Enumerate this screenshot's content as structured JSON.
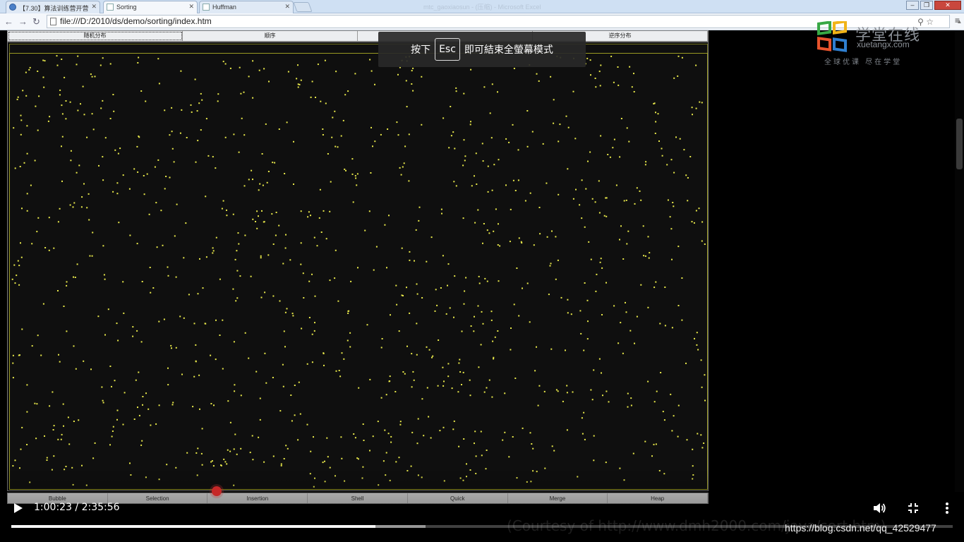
{
  "browser": {
    "tabs": [
      {
        "label": "【7.30】算法训练营开营",
        "active": false
      },
      {
        "label": "Sorting",
        "active": true
      },
      {
        "label": "Huffman",
        "active": false
      }
    ],
    "window_title": "mtc_gaoxiaosun - (压缩) - Microsoft Excel",
    "url": "file:///D:/2010/ds/demo/sorting/index.htm"
  },
  "page": {
    "distribution_buttons": [
      "随机分布",
      "顺序",
      "",
      "逆序分布"
    ],
    "selected_distribution": "随机分布",
    "algorithms": [
      "Bubble",
      "Selection",
      "Insertion",
      "Shell",
      "Quick",
      "Merge",
      "Heap"
    ],
    "dot_color": "#e8e84a"
  },
  "fullscreen_toast": {
    "prefix": "按下",
    "key": "Esc",
    "suffix": "即可結束全螢幕模式"
  },
  "brand": {
    "name": "学堂在线",
    "url": "xuetangx.com",
    "tagline": "全球优课 尽在学堂"
  },
  "player": {
    "current_time": "1:00:23",
    "duration": "2:35:56",
    "time_text": "1:00:23 / 2:35:56",
    "progress_fraction": 0.387,
    "buffered_fraction": 0.44,
    "accent_color": "#c62828"
  },
  "overlay": {
    "courtesy": "(Courtesy of http://www.dmh2000.com/java/sort.htm)",
    "watermark": "https://blog.csdn.net/qq_42529477"
  }
}
